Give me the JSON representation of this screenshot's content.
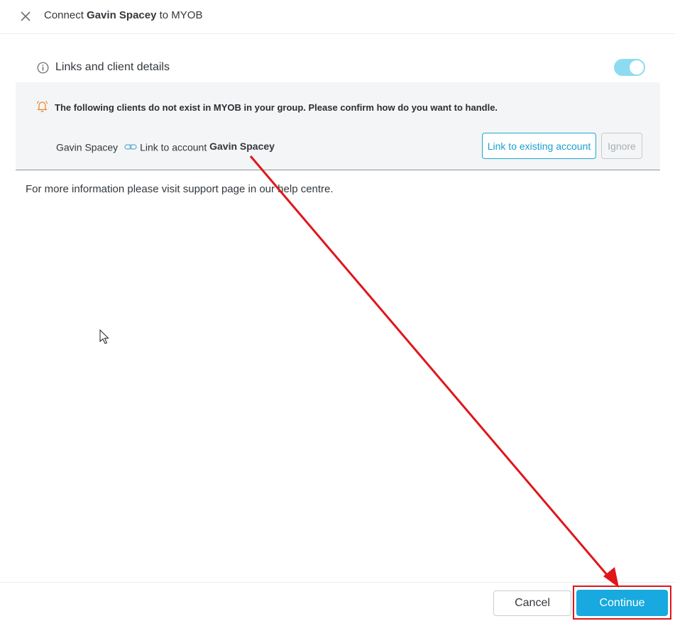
{
  "header": {
    "title_prefix": "Connect ",
    "client_name": "Gavin Spacey",
    "title_suffix": " to MYOB"
  },
  "section": {
    "label": "Links and client details",
    "toggle_on": true
  },
  "warning": {
    "message": "The following clients do not exist in MYOB in your group. Please confirm how do you want to handle."
  },
  "client_row": {
    "client_name": "Gavin Spacey",
    "link_text": "Link to account",
    "account_name": "Gavin Spacey",
    "link_button": "Link to existing account",
    "ignore_button": "Ignore"
  },
  "info": {
    "text": "For more information please visit support page in our help centre."
  },
  "footer": {
    "cancel_label": "Cancel",
    "continue_label": "Continue"
  },
  "colors": {
    "accent": "#17a9df",
    "toggle": "#8ddbf0",
    "warning_icon": "#e8832a",
    "annotation": "#e0161b"
  },
  "icons": {
    "close": "close-icon",
    "info": "info-icon",
    "bell": "bell-icon",
    "link": "link-icon",
    "cursor": "cursor-icon"
  }
}
